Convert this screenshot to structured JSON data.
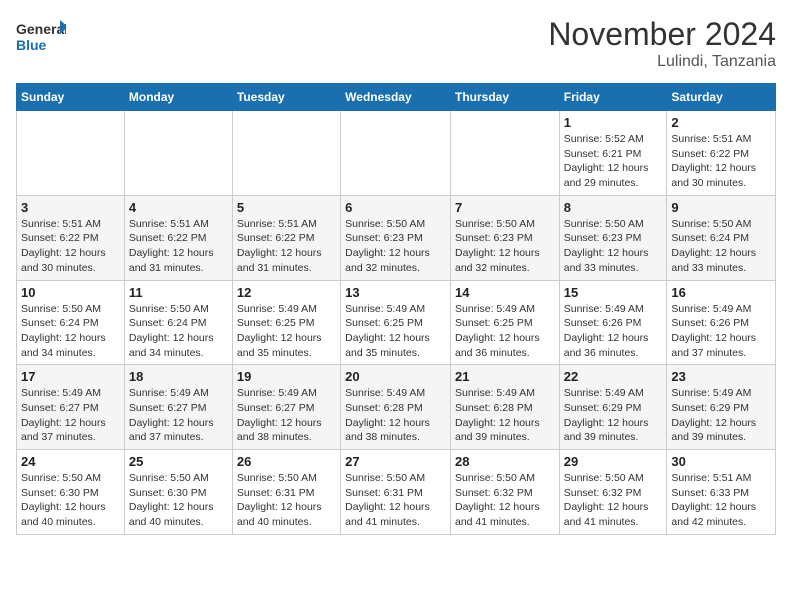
{
  "logo": {
    "line1": "General",
    "line2": "Blue"
  },
  "title": "November 2024",
  "location": "Lulindi, Tanzania",
  "weekdays": [
    "Sunday",
    "Monday",
    "Tuesday",
    "Wednesday",
    "Thursday",
    "Friday",
    "Saturday"
  ],
  "weeks": [
    [
      null,
      null,
      null,
      null,
      null,
      {
        "day": "1",
        "sunrise": "Sunrise: 5:52 AM",
        "sunset": "Sunset: 6:21 PM",
        "daylight": "Daylight: 12 hours and 29 minutes."
      },
      {
        "day": "2",
        "sunrise": "Sunrise: 5:51 AM",
        "sunset": "Sunset: 6:22 PM",
        "daylight": "Daylight: 12 hours and 30 minutes."
      }
    ],
    [
      {
        "day": "3",
        "sunrise": "Sunrise: 5:51 AM",
        "sunset": "Sunset: 6:22 PM",
        "daylight": "Daylight: 12 hours and 30 minutes."
      },
      {
        "day": "4",
        "sunrise": "Sunrise: 5:51 AM",
        "sunset": "Sunset: 6:22 PM",
        "daylight": "Daylight: 12 hours and 31 minutes."
      },
      {
        "day": "5",
        "sunrise": "Sunrise: 5:51 AM",
        "sunset": "Sunset: 6:22 PM",
        "daylight": "Daylight: 12 hours and 31 minutes."
      },
      {
        "day": "6",
        "sunrise": "Sunrise: 5:50 AM",
        "sunset": "Sunset: 6:23 PM",
        "daylight": "Daylight: 12 hours and 32 minutes."
      },
      {
        "day": "7",
        "sunrise": "Sunrise: 5:50 AM",
        "sunset": "Sunset: 6:23 PM",
        "daylight": "Daylight: 12 hours and 32 minutes."
      },
      {
        "day": "8",
        "sunrise": "Sunrise: 5:50 AM",
        "sunset": "Sunset: 6:23 PM",
        "daylight": "Daylight: 12 hours and 33 minutes."
      },
      {
        "day": "9",
        "sunrise": "Sunrise: 5:50 AM",
        "sunset": "Sunset: 6:24 PM",
        "daylight": "Daylight: 12 hours and 33 minutes."
      }
    ],
    [
      {
        "day": "10",
        "sunrise": "Sunrise: 5:50 AM",
        "sunset": "Sunset: 6:24 PM",
        "daylight": "Daylight: 12 hours and 34 minutes."
      },
      {
        "day": "11",
        "sunrise": "Sunrise: 5:50 AM",
        "sunset": "Sunset: 6:24 PM",
        "daylight": "Daylight: 12 hours and 34 minutes."
      },
      {
        "day": "12",
        "sunrise": "Sunrise: 5:49 AM",
        "sunset": "Sunset: 6:25 PM",
        "daylight": "Daylight: 12 hours and 35 minutes."
      },
      {
        "day": "13",
        "sunrise": "Sunrise: 5:49 AM",
        "sunset": "Sunset: 6:25 PM",
        "daylight": "Daylight: 12 hours and 35 minutes."
      },
      {
        "day": "14",
        "sunrise": "Sunrise: 5:49 AM",
        "sunset": "Sunset: 6:25 PM",
        "daylight": "Daylight: 12 hours and 36 minutes."
      },
      {
        "day": "15",
        "sunrise": "Sunrise: 5:49 AM",
        "sunset": "Sunset: 6:26 PM",
        "daylight": "Daylight: 12 hours and 36 minutes."
      },
      {
        "day": "16",
        "sunrise": "Sunrise: 5:49 AM",
        "sunset": "Sunset: 6:26 PM",
        "daylight": "Daylight: 12 hours and 37 minutes."
      }
    ],
    [
      {
        "day": "17",
        "sunrise": "Sunrise: 5:49 AM",
        "sunset": "Sunset: 6:27 PM",
        "daylight": "Daylight: 12 hours and 37 minutes."
      },
      {
        "day": "18",
        "sunrise": "Sunrise: 5:49 AM",
        "sunset": "Sunset: 6:27 PM",
        "daylight": "Daylight: 12 hours and 37 minutes."
      },
      {
        "day": "19",
        "sunrise": "Sunrise: 5:49 AM",
        "sunset": "Sunset: 6:27 PM",
        "daylight": "Daylight: 12 hours and 38 minutes."
      },
      {
        "day": "20",
        "sunrise": "Sunrise: 5:49 AM",
        "sunset": "Sunset: 6:28 PM",
        "daylight": "Daylight: 12 hours and 38 minutes."
      },
      {
        "day": "21",
        "sunrise": "Sunrise: 5:49 AM",
        "sunset": "Sunset: 6:28 PM",
        "daylight": "Daylight: 12 hours and 39 minutes."
      },
      {
        "day": "22",
        "sunrise": "Sunrise: 5:49 AM",
        "sunset": "Sunset: 6:29 PM",
        "daylight": "Daylight: 12 hours and 39 minutes."
      },
      {
        "day": "23",
        "sunrise": "Sunrise: 5:49 AM",
        "sunset": "Sunset: 6:29 PM",
        "daylight": "Daylight: 12 hours and 39 minutes."
      }
    ],
    [
      {
        "day": "24",
        "sunrise": "Sunrise: 5:50 AM",
        "sunset": "Sunset: 6:30 PM",
        "daylight": "Daylight: 12 hours and 40 minutes."
      },
      {
        "day": "25",
        "sunrise": "Sunrise: 5:50 AM",
        "sunset": "Sunset: 6:30 PM",
        "daylight": "Daylight: 12 hours and 40 minutes."
      },
      {
        "day": "26",
        "sunrise": "Sunrise: 5:50 AM",
        "sunset": "Sunset: 6:31 PM",
        "daylight": "Daylight: 12 hours and 40 minutes."
      },
      {
        "day": "27",
        "sunrise": "Sunrise: 5:50 AM",
        "sunset": "Sunset: 6:31 PM",
        "daylight": "Daylight: 12 hours and 41 minutes."
      },
      {
        "day": "28",
        "sunrise": "Sunrise: 5:50 AM",
        "sunset": "Sunset: 6:32 PM",
        "daylight": "Daylight: 12 hours and 41 minutes."
      },
      {
        "day": "29",
        "sunrise": "Sunrise: 5:50 AM",
        "sunset": "Sunset: 6:32 PM",
        "daylight": "Daylight: 12 hours and 41 minutes."
      },
      {
        "day": "30",
        "sunrise": "Sunrise: 5:51 AM",
        "sunset": "Sunset: 6:33 PM",
        "daylight": "Daylight: 12 hours and 42 minutes."
      }
    ]
  ]
}
